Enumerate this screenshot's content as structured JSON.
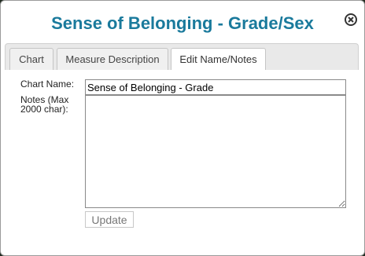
{
  "dialog": {
    "title": "Sense of Belonging - Grade/Sex",
    "close_icon": "close-circle-icon"
  },
  "tabs": [
    {
      "label": "Chart",
      "active": false
    },
    {
      "label": "Measure Description",
      "active": false
    },
    {
      "label": "Edit Name/Notes",
      "active": true
    }
  ],
  "form": {
    "chart_name_label": "Chart Name:",
    "chart_name_value": "Sense of Belonging - Grade",
    "notes_label": "Notes (Max 2000 char):",
    "notes_value": "",
    "update_label": "Update"
  },
  "colors": {
    "title": "#1a7a9c",
    "tab_bar": "#e9e9e9"
  }
}
